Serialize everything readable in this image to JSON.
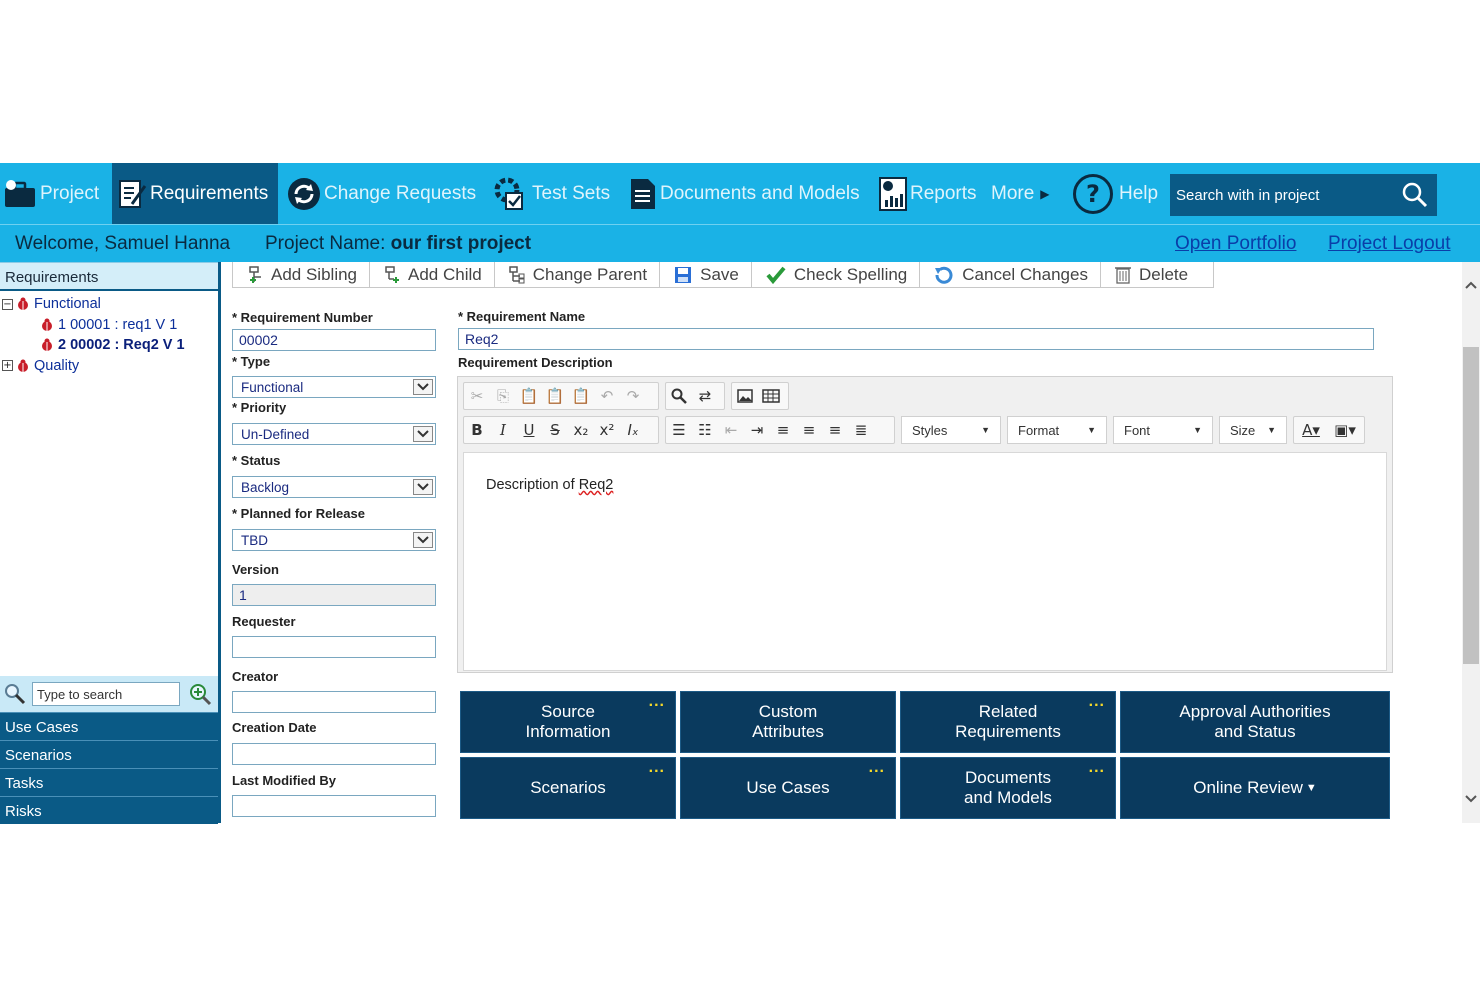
{
  "nav": {
    "project": "Project",
    "requirements": "Requirements",
    "change_requests": "Change Requests",
    "test_sets": "Test Sets",
    "documents_models": "Documents and Models",
    "reports": "Reports",
    "more": "More",
    "help": "Help",
    "search_placeholder": "Search with in project"
  },
  "welcome": {
    "user": "Welcome, Samuel Hanna",
    "project_label": "Project Name:",
    "project_name": "our first project",
    "open_portfolio": "Open Portfolio",
    "project_logout": "Project Logout"
  },
  "sidebar": {
    "title": "Requirements",
    "tree": [
      {
        "label": "Functional",
        "expander": "−"
      },
      {
        "label": "1 00001 : req1 V 1"
      },
      {
        "label": "2 00002 : Req2 V 1"
      },
      {
        "label": "Quality",
        "expander": "+"
      }
    ],
    "search_placeholder": "Type to search",
    "links": [
      "Use Cases",
      "Scenarios",
      "Tasks",
      "Risks"
    ]
  },
  "actions": [
    "Add Sibling",
    "Add Child",
    "Change Parent",
    "Save",
    "Check Spelling",
    "Cancel Changes",
    "Delete"
  ],
  "form": {
    "req_number_label": "* Requirement Number",
    "req_number": "00002",
    "type_label": "* Type",
    "type": "Functional",
    "priority_label": "* Priority",
    "priority": "Un-Defined",
    "status_label": "* Status",
    "status": "Backlog",
    "release_label": "* Planned for Release",
    "release": "TBD",
    "version_label": "Version",
    "version": "1",
    "requester_label": "Requester",
    "requester": "",
    "creator_label": "Creator",
    "creator": "",
    "creation_date_label": "Creation Date",
    "creation_date": "",
    "last_modified_label": "Last Modified By",
    "last_modified": "",
    "req_name_label": "* Requirement Name",
    "req_name": "Req2",
    "req_desc_label": "Requirement Description"
  },
  "editor": {
    "styles": "Styles",
    "format": "Format",
    "font": "Font",
    "size": "Size",
    "content_prefix": "Description of ",
    "content_word": "Req2"
  },
  "tiles": [
    {
      "line1": "Source",
      "line2": "Information",
      "dots": "..."
    },
    {
      "line1": "Custom",
      "line2": "Attributes",
      "dots": ""
    },
    {
      "line1": "Related",
      "line2": "Requirements",
      "dots": "..."
    },
    {
      "line1": "Approval Authorities",
      "line2": "and Status",
      "dots": ""
    },
    {
      "line1": "Scenarios",
      "line2": "",
      "dots": "..."
    },
    {
      "line1": "Use Cases",
      "line2": "",
      "dots": "..."
    },
    {
      "line1": "Documents",
      "line2": "and Models",
      "dots": "..."
    },
    {
      "line1": "Online Review",
      "line2": "",
      "dots": ""
    }
  ],
  "colors": {
    "nav_bg": "#1ab2e6",
    "nav_active": "#0a5a86",
    "tile_bg": "#0a3a5e",
    "tile_dots": "#f5d82a"
  }
}
